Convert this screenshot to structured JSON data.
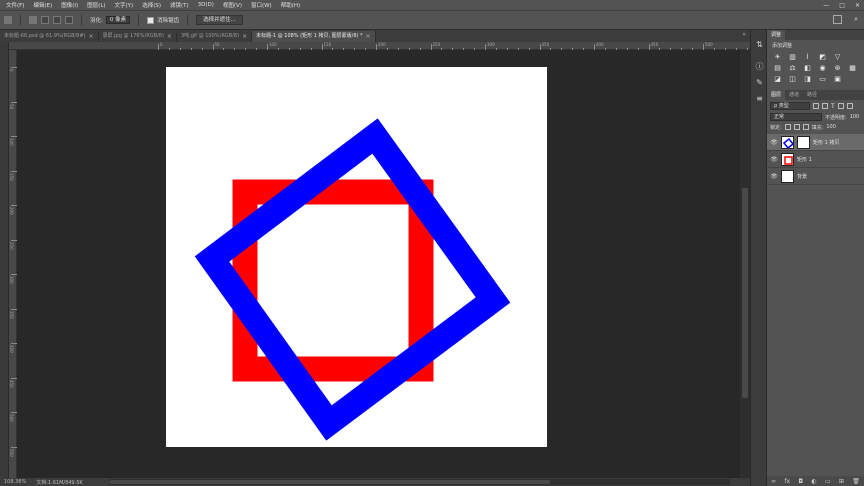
{
  "menu": [
    "文件(F)",
    "编辑(E)",
    "图像(I)",
    "图层(L)",
    "文字(Y)",
    "选择(S)",
    "滤镜(T)",
    "3D(D)",
    "视图(V)",
    "窗口(W)",
    "帮助(H)"
  ],
  "options": {
    "feather_label": "羽化:",
    "feather_value": "0 像素",
    "antialias_label": "消除锯齿",
    "select_mask_button": "选择并遮住..."
  },
  "tabs": [
    {
      "label": "未标题-66.psd @ 61.9%(RGB/8#)",
      "active": false
    },
    {
      "label": "录屏.jpg @ 176%(RGB/8)",
      "active": false
    },
    {
      "label": "3吨.gif @ 100%(RGB/8)",
      "active": false
    },
    {
      "label": "未标题-1 @ 108% (矩形 1 拷贝, 图层蒙版/8) *",
      "active": true
    }
  ],
  "status": {
    "zoom": "108.36%",
    "doc": "文档:1.61M/849.5K"
  },
  "rulers": {
    "h_labels": [
      "0",
      "50",
      "100",
      "150",
      "200",
      "250",
      "300",
      "350",
      "400",
      "450",
      "500",
      "550",
      "600",
      "650"
    ],
    "v_labels": [
      "0",
      "50",
      "100",
      "150",
      "200",
      "250",
      "300",
      "350",
      "400",
      "450",
      "500",
      "550"
    ]
  },
  "adjustments": {
    "tab": "调整",
    "title": "添加调整"
  },
  "layers_panel": {
    "tabs": [
      "图层",
      "通道",
      "路径"
    ],
    "kind_label": "ρ 类型",
    "blend_mode": "正常",
    "opacity_label": "不透明度:",
    "opacity_value": "100",
    "lock_label": "锁定:",
    "fill_label": "填充:",
    "fill_value": "100",
    "layers": [
      {
        "name": "矩形 1 拷贝",
        "selected": true
      },
      {
        "name": "矩形 1",
        "selected": false
      },
      {
        "name": "背景",
        "selected": false
      }
    ]
  },
  "colors": {
    "red_rect": "#ff0000",
    "blue_rect": "#0000ff"
  }
}
